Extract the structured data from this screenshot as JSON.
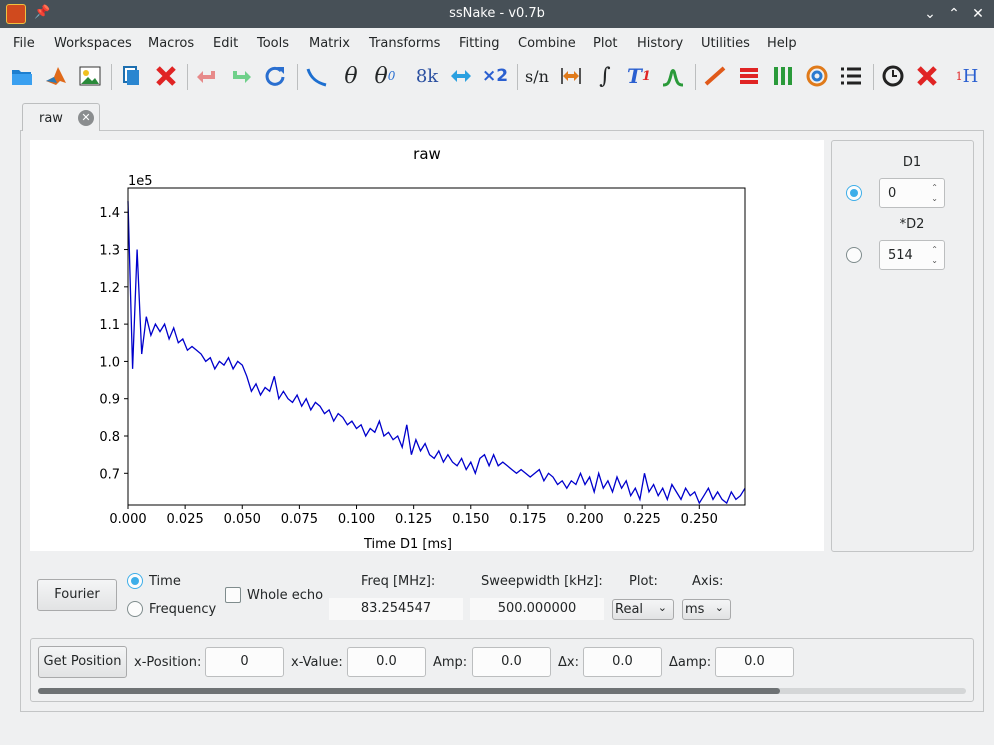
{
  "window": {
    "title": "ssNake - v0.7b"
  },
  "menu": [
    "File",
    "Workspaces",
    "Macros",
    "Edit",
    "Tools",
    "Matrix",
    "Transforms",
    "Fitting",
    "Combine",
    "Plot",
    "History",
    "Utilities",
    "Help"
  ],
  "toolbar": {
    "glyph_theta": "θ",
    "glyph_theta0": "θ",
    "glyph_theta0_sub": "0",
    "glyph_8k": "8k",
    "glyph_x2": "×2",
    "glyph_sn": "s/n",
    "glyph_integral": "∫",
    "glyph_t1": "T",
    "glyph_t1_sub": "1",
    "glyph_1h_sup": "1",
    "glyph_1h": "H"
  },
  "tabs": [
    {
      "label": "raw"
    }
  ],
  "plot": {
    "chart_data": {
      "type": "line",
      "title": "raw",
      "xlabel": "Time D1 [ms]",
      "ylabel": "",
      "y_multiplier": "1e5",
      "xlim": [
        0.0,
        0.27
      ],
      "ylim": [
        0.615,
        1.465
      ],
      "xticks": [
        "0.000",
        "0.025",
        "0.050",
        "0.075",
        "0.100",
        "0.125",
        "0.150",
        "0.175",
        "0.200",
        "0.225",
        "0.250"
      ],
      "yticks": [
        "0.7",
        "0.8",
        "0.9",
        "1.0",
        "1.1",
        "1.2",
        "1.3",
        "1.4"
      ],
      "series": [
        {
          "color": "#0000cc",
          "x": [
            0.0,
            0.002,
            0.004,
            0.006,
            0.008,
            0.01,
            0.012,
            0.014,
            0.016,
            0.018,
            0.02,
            0.022,
            0.024,
            0.026,
            0.028,
            0.03,
            0.032,
            0.034,
            0.036,
            0.038,
            0.04,
            0.042,
            0.044,
            0.046,
            0.048,
            0.05,
            0.052,
            0.054,
            0.056,
            0.058,
            0.06,
            0.062,
            0.064,
            0.066,
            0.068,
            0.07,
            0.072,
            0.074,
            0.076,
            0.078,
            0.08,
            0.082,
            0.084,
            0.086,
            0.088,
            0.09,
            0.092,
            0.094,
            0.096,
            0.098,
            0.1,
            0.102,
            0.104,
            0.106,
            0.108,
            0.11,
            0.112,
            0.114,
            0.116,
            0.118,
            0.12,
            0.122,
            0.124,
            0.126,
            0.128,
            0.13,
            0.132,
            0.134,
            0.136,
            0.138,
            0.14,
            0.142,
            0.144,
            0.146,
            0.148,
            0.15,
            0.152,
            0.154,
            0.156,
            0.158,
            0.16,
            0.162,
            0.164,
            0.166,
            0.168,
            0.17,
            0.172,
            0.174,
            0.176,
            0.178,
            0.18,
            0.182,
            0.184,
            0.186,
            0.188,
            0.19,
            0.192,
            0.194,
            0.196,
            0.198,
            0.2,
            0.202,
            0.204,
            0.206,
            0.208,
            0.21,
            0.212,
            0.214,
            0.216,
            0.218,
            0.22,
            0.222,
            0.224,
            0.226,
            0.228,
            0.23,
            0.232,
            0.234,
            0.236,
            0.238,
            0.24,
            0.242,
            0.244,
            0.246,
            0.248,
            0.25,
            0.252,
            0.254,
            0.256,
            0.258,
            0.26,
            0.262,
            0.264,
            0.266,
            0.268,
            0.27
          ],
          "y": [
            1.43,
            0.98,
            1.3,
            1.02,
            1.12,
            1.07,
            1.1,
            1.08,
            1.1,
            1.06,
            1.09,
            1.05,
            1.06,
            1.03,
            1.04,
            1.03,
            1.02,
            1.0,
            1.01,
            0.98,
            1.0,
            0.99,
            1.01,
            0.98,
            1.0,
            0.99,
            0.96,
            0.92,
            0.94,
            0.91,
            0.93,
            0.92,
            0.96,
            0.9,
            0.92,
            0.9,
            0.89,
            0.91,
            0.88,
            0.9,
            0.87,
            0.89,
            0.88,
            0.86,
            0.87,
            0.84,
            0.86,
            0.85,
            0.83,
            0.84,
            0.82,
            0.83,
            0.8,
            0.82,
            0.81,
            0.84,
            0.8,
            0.81,
            0.79,
            0.8,
            0.77,
            0.83,
            0.75,
            0.79,
            0.76,
            0.78,
            0.75,
            0.74,
            0.76,
            0.73,
            0.75,
            0.73,
            0.72,
            0.74,
            0.71,
            0.73,
            0.7,
            0.74,
            0.75,
            0.72,
            0.75,
            0.72,
            0.73,
            0.72,
            0.71,
            0.7,
            0.71,
            0.7,
            0.69,
            0.7,
            0.71,
            0.68,
            0.7,
            0.69,
            0.67,
            0.68,
            0.66,
            0.68,
            0.67,
            0.7,
            0.67,
            0.69,
            0.65,
            0.7,
            0.66,
            0.68,
            0.65,
            0.69,
            0.66,
            0.68,
            0.64,
            0.66,
            0.63,
            0.7,
            0.65,
            0.67,
            0.64,
            0.66,
            0.63,
            0.67,
            0.65,
            0.63,
            0.66,
            0.64,
            0.65,
            0.62,
            0.64,
            0.66,
            0.63,
            0.65,
            0.63,
            0.62,
            0.65,
            0.63,
            0.64,
            0.66
          ]
        }
      ]
    }
  },
  "side_panel": {
    "d1_label": "D1",
    "d1_value": "0",
    "d2_label": "*D2",
    "d2_value": "514",
    "selected": "D1"
  },
  "controls": {
    "fourier_button": "Fourier",
    "time_label": "Time",
    "frequency_label": "Frequency",
    "domain_selected": "Time",
    "whole_echo_label": "Whole echo",
    "whole_echo_checked": false,
    "freq_label": "Freq [MHz]:",
    "freq_value": "83.254547",
    "sweepwidth_label": "Sweepwidth [kHz]:",
    "sweepwidth_value": "500.000000",
    "plot_label": "Plot:",
    "plot_value": "Real",
    "axis_label": "Axis:",
    "axis_value": "ms"
  },
  "position_bar": {
    "get_position_button": "Get Position",
    "x_position_label": "x-Position:",
    "x_position_value": "0",
    "x_value_label": "x-Value:",
    "x_value_value": "0.0",
    "amp_label": "Amp:",
    "amp_value": "0.0",
    "dx_label": "Δx:",
    "dx_value": "0.0",
    "damp_label": "Δamp:",
    "damp_value": "0.0",
    "scroll_position": 0.8
  }
}
